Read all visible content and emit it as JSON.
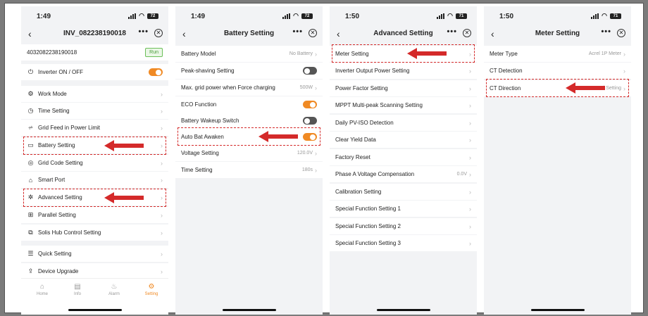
{
  "colors": {
    "accent": "#f08a24",
    "highlight": "#d42a2a",
    "run_green": "#6bbf59"
  },
  "screen1": {
    "time": "1:49",
    "battery": "72",
    "title": "INV_082238190018",
    "serial": "4032082238190018",
    "run_badge": "Run",
    "items": [
      {
        "label": "Inverter ON / OFF",
        "icon": "power-icon"
      },
      {
        "label": "Work Mode",
        "icon": "gear-icon"
      },
      {
        "label": "Time Setting",
        "icon": "clock-icon"
      },
      {
        "label": "Grid Feed in Power Limit",
        "icon": "tower-icon"
      },
      {
        "label": "Battery Setting",
        "icon": "battery-icon"
      },
      {
        "label": "Grid Code Setting",
        "icon": "grid-code-icon"
      },
      {
        "label": "Smart Port",
        "icon": "port-icon"
      },
      {
        "label": "Advanced Setting",
        "icon": "advanced-gear-icon"
      },
      {
        "label": "Parallel Setting",
        "icon": "parallel-icon"
      },
      {
        "label": "Solis Hub Control Setting",
        "icon": "hub-icon"
      },
      {
        "label": "Quick Setting",
        "icon": "quick-icon"
      },
      {
        "label": "Device Upgrade",
        "icon": "upgrade-icon"
      }
    ],
    "tabs": [
      {
        "label": "Home",
        "icon": "home-icon"
      },
      {
        "label": "Info",
        "icon": "info-icon"
      },
      {
        "label": "Alarm",
        "icon": "alarm-icon"
      },
      {
        "label": "Setting",
        "icon": "setting-icon"
      }
    ]
  },
  "screen2": {
    "time": "1:49",
    "battery": "72",
    "title": "Battery Setting",
    "items": [
      {
        "label": "Battery Model",
        "value": "No Battery"
      },
      {
        "label": "Peak-shaving Setting",
        "toggle": "off"
      },
      {
        "label": "Max. grid power when Force charging",
        "value": "500W"
      },
      {
        "label": "ECO Function",
        "toggle": "on"
      },
      {
        "label": "Battery Wakeup Switch",
        "toggle": "off"
      },
      {
        "label": "Auto Bat Awaken",
        "toggle": "on"
      },
      {
        "label": "Voltage Setting",
        "value": "120.0V"
      },
      {
        "label": "Time Setting",
        "value": "180s"
      }
    ]
  },
  "screen3": {
    "time": "1:50",
    "battery": "71",
    "title": "Advanced Setting",
    "items": [
      {
        "label": "Meter Setting"
      },
      {
        "label": "Inverter Output Power Setting"
      },
      {
        "label": "Power Factor Setting"
      },
      {
        "label": "MPPT Multi-peak Scanning Setting"
      },
      {
        "label": "Daily PV-ISO Detection"
      },
      {
        "label": "Clear Yield Data"
      },
      {
        "label": "Factory Reset"
      },
      {
        "label": "Phase A Voltage Compensation",
        "value": "0.0V"
      },
      {
        "label": "Calibration Setting"
      },
      {
        "label": "Special Function Setting 1"
      },
      {
        "label": "Special Function Setting 2"
      },
      {
        "label": "Special Function Setting 3"
      }
    ]
  },
  "screen4": {
    "time": "1:50",
    "battery": "71",
    "title": "Meter Setting",
    "items": [
      {
        "label": "Meter Type",
        "value": "Acrel 1P Meter"
      },
      {
        "label": "CT Detection"
      },
      {
        "label": "CT Direction",
        "value": "Forward Setting"
      }
    ]
  }
}
